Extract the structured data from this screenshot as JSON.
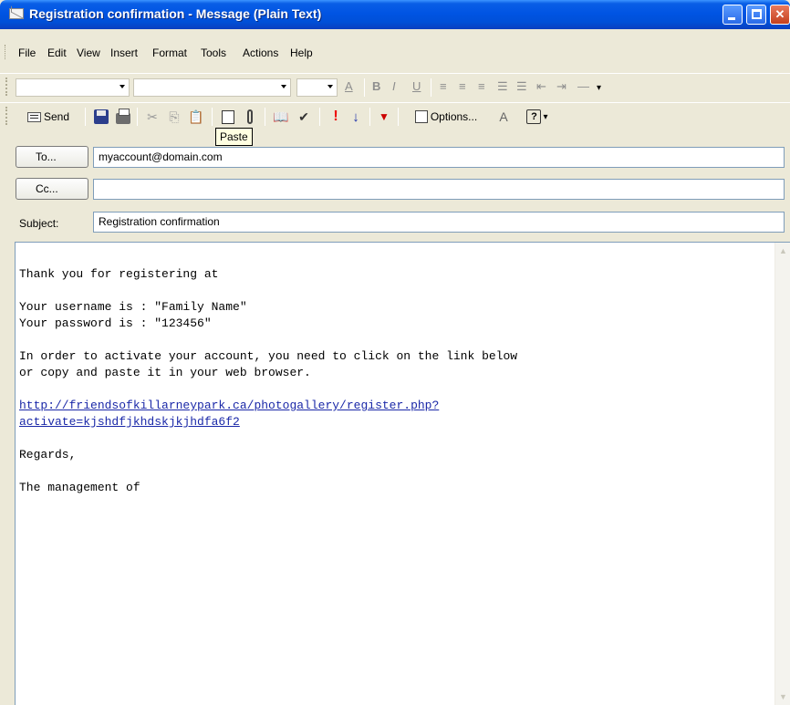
{
  "window": {
    "title": "Registration confirmation - Message (Plain Text)"
  },
  "menu": {
    "items": [
      "File",
      "Edit",
      "View",
      "Insert",
      "Format",
      "Tools",
      "Actions",
      "Help"
    ]
  },
  "toolbar": {
    "send_label": "Send",
    "options_label": "Options...",
    "tooltip": "Paste"
  },
  "header": {
    "to_button": "To...",
    "cc_button": "Cc...",
    "subject_label": "Subject:",
    "to_value": "myaccount@domain.com",
    "cc_value": "",
    "subject_value": "Registration confirmation"
  },
  "body": {
    "line1": "Thank you for registering at",
    "line2": "Your username is : \"Family Name\"",
    "line3": "Your password is : \"123456\"",
    "line4": "In order to activate your account, you need to click on the link below",
    "line5": "or copy and paste it in your web browser.",
    "link_line1": "http://friendsofkillarneypark.ca/photogallery/register.php?",
    "link_line2": "activate=kjshdfjkhdskjkjhdfa6f2",
    "line6": "Regards,",
    "line7": "The management of"
  },
  "colors": {
    "titlebar": "#0054e3",
    "link": "#1a28a8",
    "chrome": "#ece9d8"
  }
}
